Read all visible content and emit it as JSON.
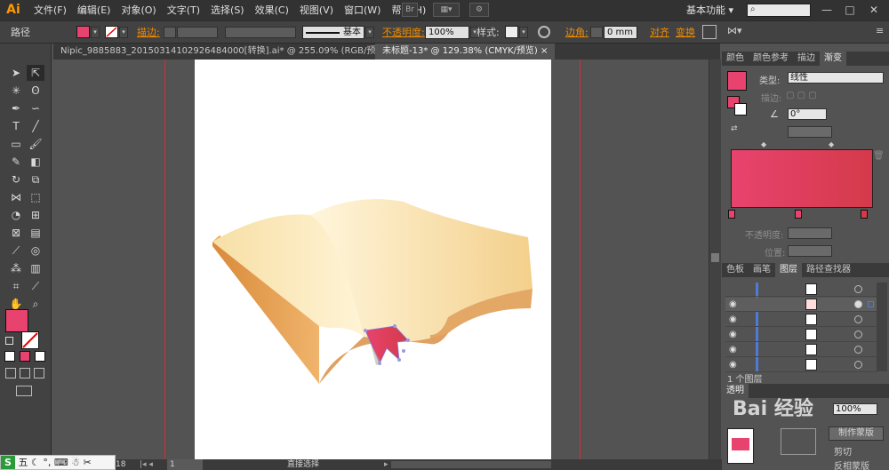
{
  "app": {
    "logo": "Ai"
  },
  "menu": [
    "文件(F)",
    "编辑(E)",
    "对象(O)",
    "文字(T)",
    "选择(S)",
    "效果(C)",
    "视图(V)",
    "窗口(W)",
    "帮助(H)"
  ],
  "workspace": {
    "label": "基本功能",
    "chevron": "▾"
  },
  "window_controls": [
    "—",
    "□",
    "✕"
  ],
  "control_bar": {
    "selection_label": "路径",
    "stroke_label": "描边:",
    "stroke_style": "基本",
    "opacity_label": "不透明度:",
    "opacity_value": "100%",
    "style_label": "样式:",
    "corner_label": "边角:",
    "corner_value": "0 mm",
    "align_label": "对齐",
    "transform_label": "变换"
  },
  "tabs": [
    {
      "label": "Nipic_9885883_20150314102926484000[转换].ai* @ 255.09% (RGB/预览)",
      "close": "×",
      "active": false
    },
    {
      "label": "未标题-13* @ 129.38% (CMYK/预览)",
      "close": "×",
      "active": true
    }
  ],
  "gradient_panel": {
    "tabs": [
      "颜色",
      "颜色参考",
      "描边",
      "渐变"
    ],
    "active_tab": "渐变",
    "type_label": "类型:",
    "type_value": "线性",
    "stroke_label": "描边:",
    "angle_value": "0°",
    "opacity_label": "不透明度:",
    "position_label": "位置:",
    "gradient_start": "#e8436e",
    "gradient_end": "#d43a4a"
  },
  "layers_panel": {
    "tabs": [
      "色板",
      "画笔",
      "图层",
      "路径查找器"
    ],
    "active_tab": "图层",
    "footer": "1 个图层"
  },
  "transparency_panel": {
    "title": "透明",
    "opacity_value": "100%",
    "make_mask": "制作蒙版",
    "clip": "剪切",
    "invert_mask": "反相蒙版"
  },
  "status_bar": {
    "zoom": "18",
    "page": "1",
    "tool": "直接选择"
  },
  "ime": {
    "label": "五"
  },
  "watermark": {
    "text": "Bai 经验"
  },
  "colors": {
    "fill": "#e8436e",
    "accent_orange": "#f08c00",
    "guide_red": "#c8343a"
  }
}
